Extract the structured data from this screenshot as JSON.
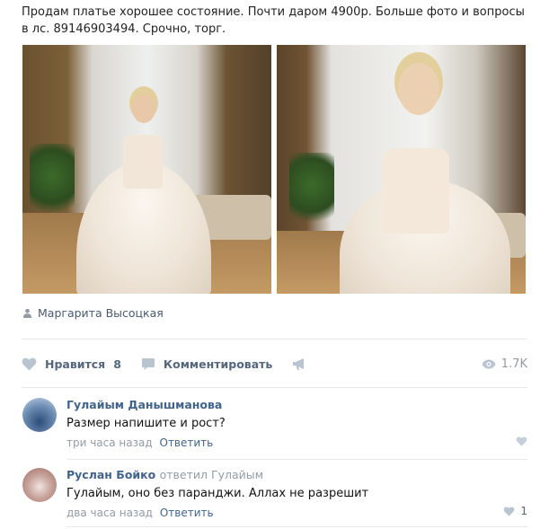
{
  "post": {
    "text": "Продам платье хорошее состояние. Почти даром 4900р. Больше фото и вопросы в лс. 89146903494. Срочно, торг.",
    "author_label": "Маргарита Высоцкая"
  },
  "actions": {
    "like_label": "Нравится",
    "like_count": "8",
    "comment_label": "Комментировать",
    "views_count": "1.7K"
  },
  "comments": [
    {
      "author": "Гулайым Данышманова",
      "replied_to": "",
      "text": "Размер напишите и рост?",
      "time": "три часа назад",
      "reply_label": "Ответить",
      "likes": ""
    },
    {
      "author": "Руслан Бойко",
      "replied_to": "ответил Гулайым",
      "text": "Гулайым, оно без паранджи. Аллах не разрешит",
      "time": "два часа назад",
      "reply_label": "Ответить",
      "likes": "1"
    }
  ],
  "icons": {
    "person": "person-icon",
    "heart": "heart-icon",
    "comment": "comment-icon",
    "share": "share-megaphone-icon",
    "eye": "eye-icon"
  },
  "colors": {
    "link": "#42648b",
    "muted": "#939ba5",
    "action": "#55677d",
    "icon": "#b9c4d1"
  }
}
